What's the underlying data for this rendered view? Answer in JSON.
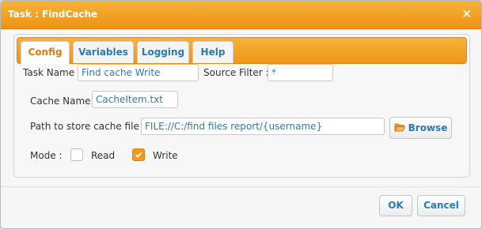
{
  "dialog": {
    "title": "Task : FindCache",
    "close_glyph": "×"
  },
  "tabs": [
    {
      "label": "Config",
      "active": true
    },
    {
      "label": "Variables",
      "active": false
    },
    {
      "label": "Logging",
      "active": false
    },
    {
      "label": "Help",
      "active": false
    }
  ],
  "form": {
    "task_name_label": "Task Name :",
    "task_name_value": "Find cache Write",
    "source_filter_label": "Source Filter :",
    "source_filter_value": "*",
    "cache_name_label": "Cache Name :",
    "cache_name_value": "CacheItem.txt",
    "path_label": "Path to store cache file :",
    "path_value": "FILE://C:/find files report/{username}",
    "browse_label": "Browse",
    "browse_icon": "folder-open-icon",
    "mode_label": "Mode :",
    "mode_options": [
      {
        "label": "Read",
        "checked": false
      },
      {
        "label": "Write",
        "checked": true
      }
    ]
  },
  "footer": {
    "ok_label": "OK",
    "cancel_label": "Cancel"
  },
  "colors": {
    "accent": "#f0a020",
    "link": "#2a7bb5",
    "active_tab_text": "#e27b05"
  }
}
